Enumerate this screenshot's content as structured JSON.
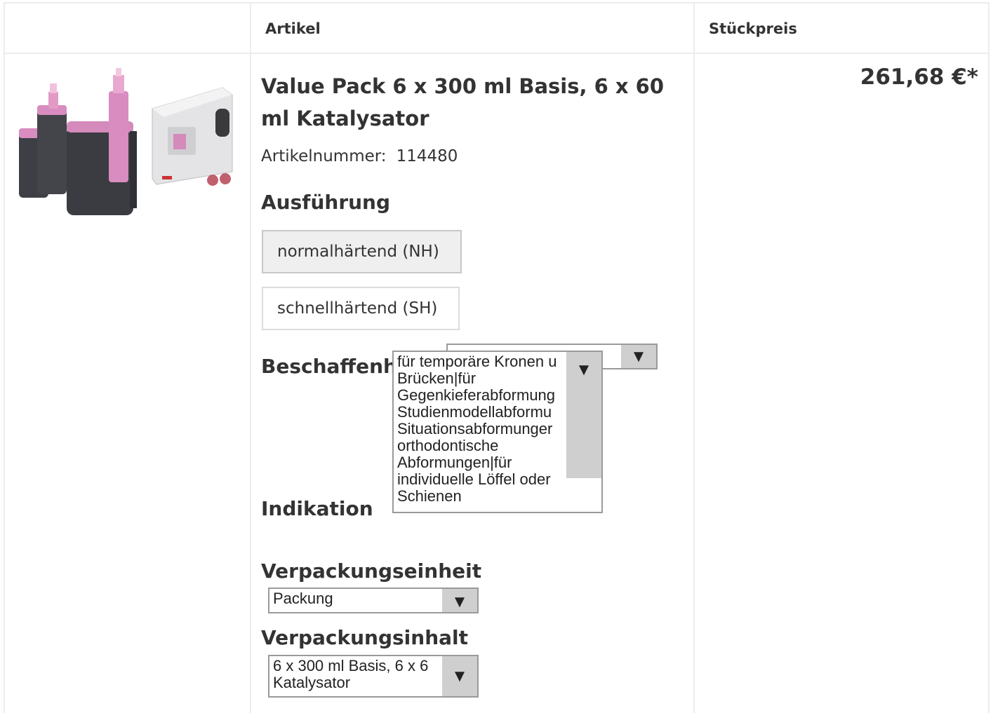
{
  "table": {
    "headers": {
      "col_article": "Artikel",
      "col_unit_price": "Stückpreis"
    }
  },
  "product": {
    "title": "Value Pack 6 x 300 ml Basis, 6 x 60 ml Katalysator",
    "article_number_label": "Artikelnummer:",
    "article_number": "114480",
    "unit_price": "261,68 €*",
    "image_icon": "product-photo-icon"
  },
  "ausfuehrung": {
    "label": "Ausführung",
    "options": [
      "normalhärtend (NH)",
      "schnellhärtend (SH)"
    ],
    "selected_index": 0
  },
  "beschaffenheit": {
    "label": "Beschaffenheit",
    "selected_value": "",
    "arrow": "▼"
  },
  "indikation": {
    "label": "Indikation",
    "selected_value": "für temporäre Kronen und Brücken|für Gegenkieferabformungen|für Studienmodellabformungen|für Situationsabformungen|für orthodontische Abformungen|für individuelle Löffel oder Schienen",
    "visible_text": "für temporäre Kronen u\nBrücken|für\nGegenkieferabformung\nStudienmodellabformu\nSituationsabformunger\northodontische\nAbformungen|für\nindividuelle Löffel oder\nSchienen",
    "arrow": "▼"
  },
  "verpackungseinheit": {
    "label": "Verpackungseinheit",
    "selected_value": "Packung",
    "arrow": "▼"
  },
  "verpackungsinhalt": {
    "label": "Verpackungsinhalt",
    "visible_text": "6 x 300 ml Basis, 6 x 6\nKatalysator",
    "arrow": "▼"
  }
}
